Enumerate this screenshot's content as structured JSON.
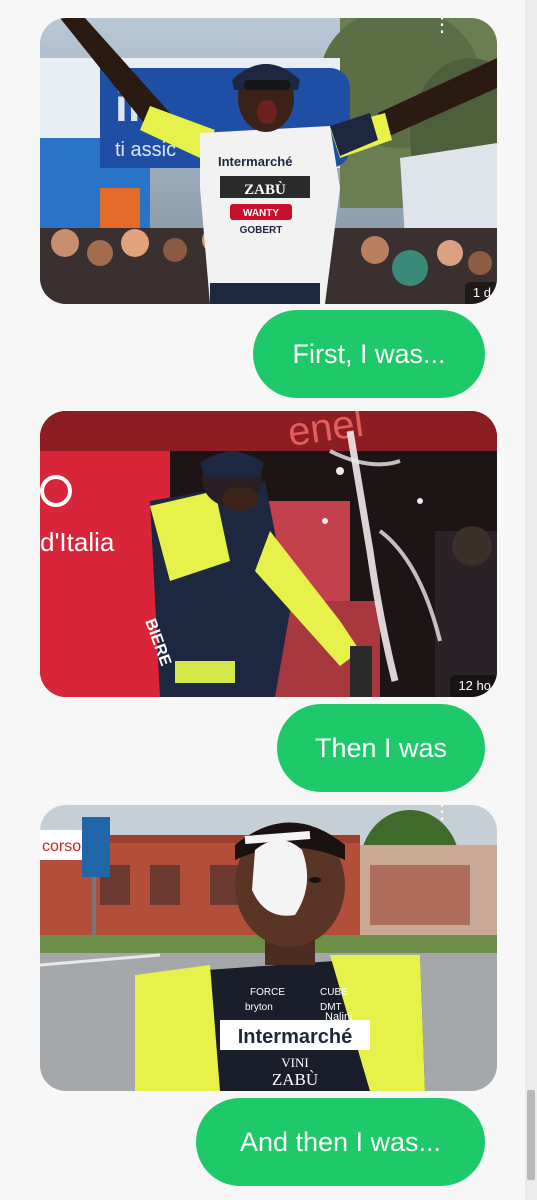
{
  "messages": [
    {
      "type": "image",
      "subject": "cyclist celebrating with arms raised",
      "overlay": "1 d"
    },
    {
      "type": "text",
      "text": "First, I was..."
    },
    {
      "type": "image",
      "subject": "cyclist on podium sprayed by champagne cork",
      "overlay": "12 ho"
    },
    {
      "type": "text",
      "text": "Then I was"
    },
    {
      "type": "image",
      "subject": "cyclist with eye bandage",
      "overlay": ""
    },
    {
      "type": "text",
      "text": "And then I was..."
    }
  ],
  "image_text": {
    "sponsor_main": "Intermarché",
    "sponsor_vini": "VINI",
    "sponsor_zabu": "ZABÙ",
    "banner_giro": "d'Italia",
    "banner_enel": "enel",
    "street_sign": "corso",
    "sponsor_wanty": "WANTY",
    "sponsor_gobert": "GOBERT",
    "sponsor_nalini": "Nalini",
    "sponsor_bryton": "bryton",
    "sponsor_force": "FORCE",
    "sponsor_cube": "CUBE",
    "sponsor_dmt": "DMT",
    "sponsor_biere": "BIERE",
    "banner_assicura": "ti assic"
  },
  "colors": {
    "bubble_bg": "#1ec96a",
    "bubble_text": "#ffffff",
    "app_bg": "#f7f7f7",
    "jersey_yellow": "#e6f24a",
    "jersey_navy": "#1e2740",
    "podium_red": "#d8253a"
  },
  "icons": {
    "more_options": "more-vert-icon",
    "scrollbar": "scrollbar-thumb"
  }
}
